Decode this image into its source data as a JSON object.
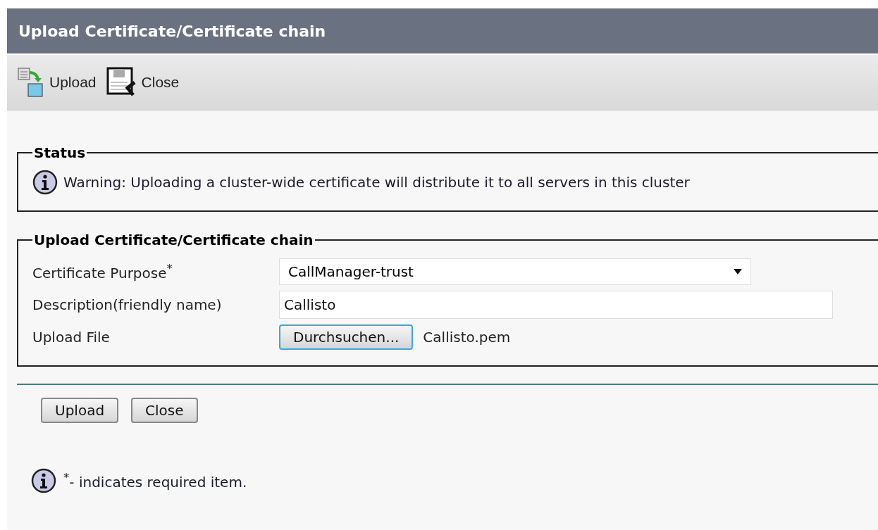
{
  "window": {
    "title": "Upload Certificate/Certificate chain"
  },
  "toolbar": [
    {
      "kind": "upload",
      "label": "Upload"
    },
    {
      "kind": "close",
      "label": "Close"
    }
  ],
  "status": {
    "legend": "Status",
    "message": "Warning: Uploading a cluster-wide certificate will distribute it to all servers in this cluster"
  },
  "form": {
    "legend": "Upload Certificate/Certificate chain",
    "fields": [
      {
        "kind": "select",
        "label": "Certificate Purpose$^{*}$",
        "value": "CallManager-trust"
      },
      {
        "kind": "text",
        "label": "Description(friendly name)",
        "value": "Callisto"
      },
      {
        "kind": "file",
        "label": "Upload File",
        "button": "Durchsuchen...",
        "value": "Callisto.pem"
      }
    ]
  },
  "buttons": [
    "Upload",
    "Close"
  ],
  "note": "$^{*}$- indicates required item."
}
